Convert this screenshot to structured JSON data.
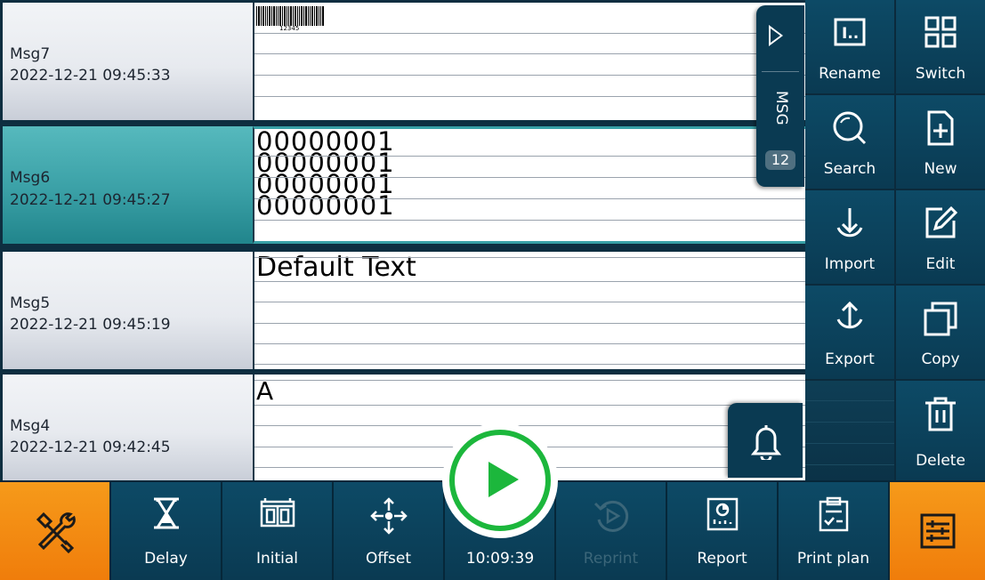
{
  "messages": [
    {
      "name": "Msg7",
      "date": "2022-12-21 09:45:33",
      "preview": "12345"
    },
    {
      "name": "Msg6",
      "date": "2022-12-21 09:45:27",
      "preview": [
        "00000001",
        "00000001",
        "00000001",
        "00000001"
      ]
    },
    {
      "name": "Msg5",
      "date": "2022-12-21 09:45:19",
      "preview": "Default Text"
    },
    {
      "name": "Msg4",
      "date": "2022-12-21 09:42:45",
      "preview": "A"
    }
  ],
  "msg_tab": {
    "label": "MSG",
    "count": "12"
  },
  "side": {
    "rename": "Rename",
    "switch": "Switch",
    "search": "Search",
    "new": "New",
    "import": "Import",
    "edit": "Edit",
    "export": "Export",
    "copy": "Copy",
    "delete": "Delete"
  },
  "bottom": {
    "delay": "Delay",
    "initial": "Initial",
    "offset": "Offset",
    "time": "10:09:39",
    "reprint": "Reprint",
    "report": "Report",
    "print_plan": "Print plan"
  },
  "colors": {
    "accent": "#38a0a6",
    "orange": "#f07d0b",
    "green": "#1cb73c",
    "panel": "#0a3a52"
  }
}
